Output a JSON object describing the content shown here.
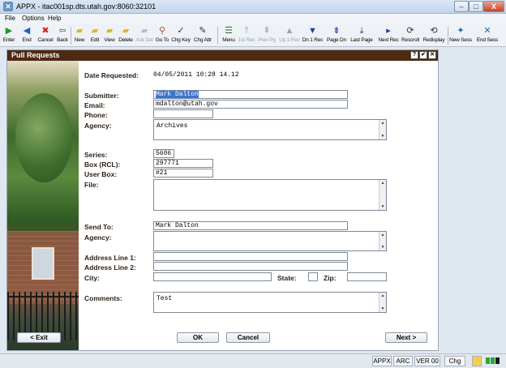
{
  "window": {
    "title": "APPX - itac001sp.dts.utah.gov:8060:32101",
    "min_label": "–",
    "max_label": "□",
    "close_label": "X"
  },
  "menu": [
    "File",
    "Options",
    "Help"
  ],
  "toolbar": [
    {
      "label": "Enter",
      "icon": "play-icon",
      "glyph": "▶",
      "color": "#1e9a1e",
      "enabled": true
    },
    {
      "label": "End",
      "icon": "back-arrow-icon",
      "glyph": "◀",
      "color": "#1f5fc8",
      "enabled": true
    },
    {
      "label": "Cancel",
      "icon": "cancel-icon",
      "glyph": "✖",
      "color": "#d0281e",
      "enabled": true
    },
    {
      "label": "Back",
      "icon": "back-icon",
      "glyph": "⇦",
      "color": "#555555",
      "enabled": true
    },
    {
      "label": "New",
      "icon": "folder-new-icon",
      "glyph": "▰",
      "color": "#e6b422",
      "enabled": true
    },
    {
      "label": "Edit",
      "icon": "folder-edit-icon",
      "glyph": "▰",
      "color": "#e6b422",
      "enabled": true
    },
    {
      "label": "View",
      "icon": "folder-view-icon",
      "glyph": "▰",
      "color": "#e6b422",
      "enabled": true
    },
    {
      "label": "Delete",
      "icon": "folder-delete-icon",
      "glyph": "▰",
      "color": "#e6b422",
      "enabled": true
    },
    {
      "label": "Ask Del",
      "icon": "folder-ask-delete-icon",
      "glyph": "▰",
      "color": "#b9bec5",
      "enabled": false
    },
    {
      "label": "Go To",
      "icon": "magnifier-icon",
      "glyph": "⚲",
      "color": "#a0522d",
      "enabled": true
    },
    {
      "label": "Chg Key",
      "icon": "key-icon",
      "glyph": "✓",
      "color": "#333333",
      "enabled": true
    },
    {
      "label": "Chg Attr",
      "icon": "attribute-icon",
      "glyph": "✎",
      "color": "#333333",
      "enabled": true
    },
    {
      "label": "Menu",
      "icon": "menu-icon",
      "glyph": "☰",
      "color": "#2a7a2a",
      "enabled": true
    },
    {
      "label": "1st Rec",
      "icon": "first-record-icon",
      "glyph": "⤒",
      "color": "#9aa3ad",
      "enabled": false
    },
    {
      "label": "Prev Pg",
      "icon": "previous-page-icon",
      "glyph": "⇞",
      "color": "#9aa3ad",
      "enabled": false
    },
    {
      "label": "Up 1 Rec",
      "icon": "up-record-icon",
      "glyph": "▲",
      "color": "#9aa3ad",
      "enabled": false
    },
    {
      "label": "Dn 1 Rec",
      "icon": "down-record-icon",
      "glyph": "▼",
      "color": "#1f3f9a",
      "enabled": true
    },
    {
      "label": "Page Dn",
      "icon": "page-down-icon",
      "glyph": "⇟",
      "color": "#1f3f9a",
      "enabled": true
    },
    {
      "label": "Last Page",
      "icon": "last-page-icon",
      "glyph": "⤓",
      "color": "#1f3f9a",
      "enabled": true
    },
    {
      "label": "Next Rec",
      "icon": "next-record-icon",
      "glyph": "▸",
      "color": "#1f3f9a",
      "enabled": true
    },
    {
      "label": "Rescroll",
      "icon": "rescroll-icon",
      "glyph": "⟳",
      "color": "#333333",
      "enabled": true
    },
    {
      "label": "Redisplay",
      "icon": "redisplay-icon",
      "glyph": "⟲",
      "color": "#333333",
      "enabled": true
    },
    {
      "label": "New Sess",
      "icon": "new-session-icon",
      "glyph": "✦",
      "color": "#2a6a9a",
      "enabled": true
    },
    {
      "label": "End Sess",
      "icon": "end-session-icon",
      "glyph": "✕",
      "color": "#2a6a9a",
      "enabled": true
    }
  ],
  "panel": {
    "title": "Pull Requests",
    "help_label": "?",
    "check_label": "✔",
    "close_label": "✕"
  },
  "form": {
    "date_requested_label": "Date Requested:",
    "date_requested_value": "04/05/2011 10:28 14.12",
    "submitter_label": "Submitter:",
    "submitter_value": "Mark Dalton",
    "email_label": "Email:",
    "email_value": "mdalton@utah.gov",
    "phone_label": "Phone:",
    "phone_value": "",
    "agency_label": "Agency:",
    "agency_value": "Archives",
    "series_label": "Series:",
    "series_value": "5606",
    "box_label": "Box (RCL):",
    "box_value": "297771",
    "userbox_label": "User Box:",
    "userbox_value": "#21",
    "file_label": "File:",
    "file_value": "",
    "sendto_label": "Send To:",
    "sendto_value": "Mark Dalton",
    "sendto_agency_label": "Agency:",
    "sendto_agency_value": "",
    "address1_label": "Address Line 1:",
    "address1_value": "",
    "address2_label": "Address Line 2:",
    "address2_value": "",
    "city_label": "City:",
    "city_value": "",
    "state_label": "State:",
    "state_value": "",
    "zip_label": "Zip:",
    "zip_value": "",
    "comments_label": "Comments:",
    "comments_value": "Test"
  },
  "buttons": {
    "exit": "< Exit",
    "ok": "OK",
    "cancel": "Cancel",
    "next": "Next >"
  },
  "status": {
    "cells": [
      "APPX",
      "ARC",
      "VER 00",
      "Chg"
    ]
  }
}
